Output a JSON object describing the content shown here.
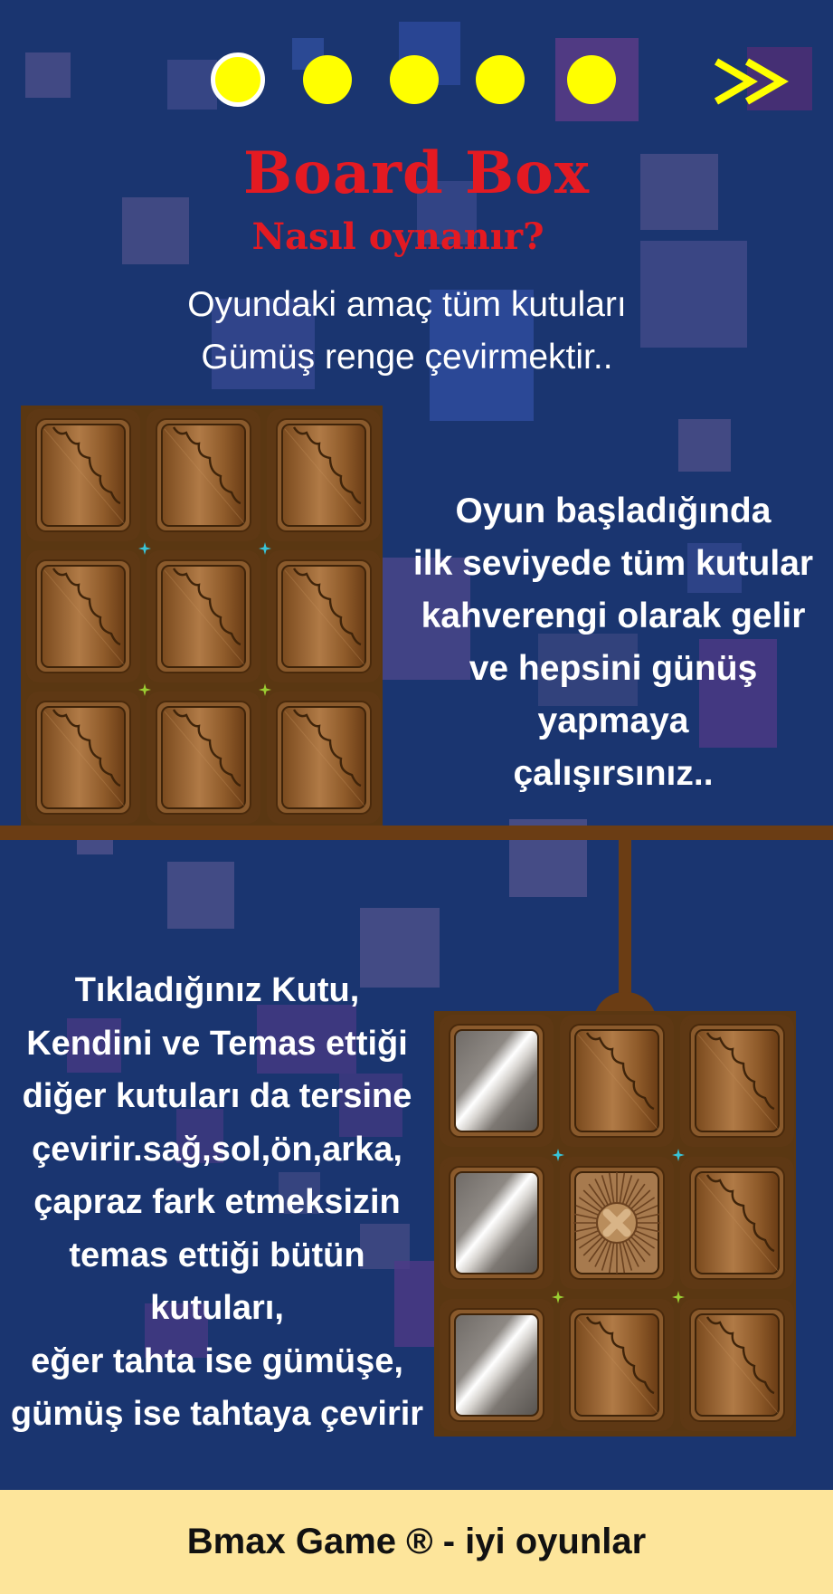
{
  "colors": {
    "background": "#1a3570",
    "title_red": "#e41a22",
    "dot_yellow": "#ffff00",
    "wood": "#6b3d14",
    "footer_bg": "#fde59b"
  },
  "nav": {
    "dots": [
      {
        "name": "page-dot-1",
        "active": true
      },
      {
        "name": "page-dot-2",
        "active": false
      },
      {
        "name": "page-dot-3",
        "active": false
      },
      {
        "name": "page-dot-4",
        "active": false
      },
      {
        "name": "page-dot-5",
        "active": false
      }
    ],
    "next_icon": "double-chevron-right-icon"
  },
  "header": {
    "title": "Board Box",
    "subtitle": "Nasıl oynanır?"
  },
  "intro": {
    "line1": "Oyundaki amaç tüm kutuları",
    "line2": "Gümüş renge çevirmektir.."
  },
  "section1": {
    "lines": [
      "Oyun başladığında",
      "ilk seviyede tüm kutular",
      "kahverengi olarak gelir",
      "ve hepsini günüş",
      "yapmaya",
      "çalışırsınız.."
    ],
    "board": [
      [
        "wood",
        "wood",
        "wood"
      ],
      [
        "wood",
        "wood",
        "wood"
      ],
      [
        "wood",
        "wood",
        "wood"
      ]
    ]
  },
  "section2": {
    "lines": [
      "Tıkladığınız Kutu,",
      "Kendini ve Temas ettiği",
      "diğer kutuları da tersine",
      "çevirir.sağ,sol,ön,arka,",
      "çapraz fark etmeksizin",
      "temas ettiği bütün",
      "kutuları,",
      "eğer tahta ise gümüşe,",
      "gümüş ise tahtaya çevirir"
    ],
    "board": [
      [
        "silver",
        "wood",
        "wood"
      ],
      [
        "silver",
        "clicked",
        "wood"
      ],
      [
        "silver",
        "wood",
        "wood"
      ]
    ]
  },
  "footer": {
    "text": "Bmax Game ® - iyi oyunlar"
  }
}
